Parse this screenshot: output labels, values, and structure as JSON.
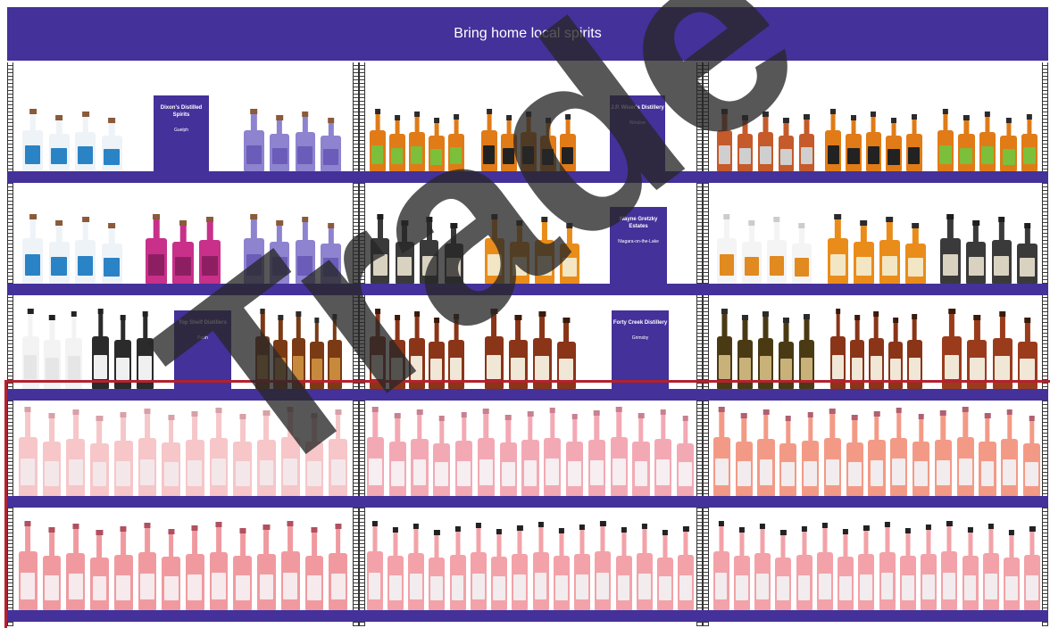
{
  "banner": {
    "title": "Bring home local spirits"
  },
  "colors": {
    "shelf": "#44319a",
    "frame": "#b3222e"
  },
  "signs": [
    {
      "name": "Dixon's Distilled Spirits",
      "city": "Guelph"
    },
    {
      "name": "J.P. Wiser's Distillery",
      "city": "Windsor"
    },
    {
      "name": "Wayne Gretzky Estates",
      "city": "Niagara-on-the-Lake"
    },
    {
      "name": "Top Shelf Distillers",
      "city": "Perth"
    },
    {
      "name": "Forty Creek Distillery",
      "city": "Grimsby"
    }
  ],
  "watermark": {
    "text": "Trade"
  },
  "shelves": [
    {
      "name": "spirits-row-1"
    },
    {
      "name": "spirits-row-2"
    },
    {
      "name": "spirits-row-3"
    },
    {
      "name": "rose-row-1"
    },
    {
      "name": "rose-row-2"
    }
  ],
  "product_groups": [
    {
      "row": 0,
      "count": 4,
      "glass": "#eef3f8",
      "label": "#2a83c5",
      "cap": "#8a5a3a"
    },
    {
      "row": 0,
      "count": 4,
      "glass": "#8d83cf",
      "label": "#6a5cb8",
      "cap": "#8a5a3a"
    },
    {
      "row": 0,
      "count": 5,
      "glass": "#e07b17",
      "label": "#7bbf3a",
      "cap": "#2b2b2b"
    },
    {
      "row": 0,
      "count": 5,
      "glass": "#e07b17",
      "label": "#222222",
      "cap": "#2b2b2b"
    },
    {
      "row": 0,
      "count": 5,
      "glass": "#c55a2a",
      "label": "#cfcfcf",
      "cap": "#2b2b2b"
    },
    {
      "row": 0,
      "count": 5,
      "glass": "#e07b17",
      "label": "#222222",
      "cap": "#2b2b2b"
    },
    {
      "row": 0,
      "count": 5,
      "glass": "#e07b17",
      "label": "#7bbf3a",
      "cap": "#2b2b2b"
    },
    {
      "row": 1,
      "count": 4,
      "glass": "#eef3f8",
      "label": "#2a83c5",
      "cap": "#8a5a3a"
    },
    {
      "row": 1,
      "count": 3,
      "glass": "#c8308a",
      "label": "#8e1e62",
      "cap": "#8a5a3a"
    },
    {
      "row": 1,
      "count": 4,
      "glass": "#8d83cf",
      "label": "#6a5cb8",
      "cap": "#8a5a3a"
    },
    {
      "row": 1,
      "count": 4,
      "glass": "#3a3a3a",
      "label": "#d9d2c0",
      "cap": "#1e1e1e"
    },
    {
      "row": 1,
      "count": 4,
      "glass": "#e98c1a",
      "label": "#f3e6c4",
      "cap": "#2b2b2b"
    },
    {
      "row": 1,
      "count": 4,
      "glass": "#f4f4f4",
      "label": "#e08a1f",
      "cap": "#cccccc"
    },
    {
      "row": 1,
      "count": 4,
      "glass": "#e98c1a",
      "label": "#f3e6c4",
      "cap": "#2b2b2b"
    },
    {
      "row": 1,
      "count": 4,
      "glass": "#3a3a3a",
      "label": "#d9d2c0",
      "cap": "#1e1e1e"
    },
    {
      "row": 2,
      "count": 3,
      "glass": "#f3f3f3",
      "label": "#e6e6e6",
      "cap": "#222222"
    },
    {
      "row": 2,
      "count": 3,
      "glass": "#2b2b2b",
      "label": "#f0f0f0",
      "cap": "#222222"
    },
    {
      "row": 2,
      "count": 5,
      "glass": "#7a3a14",
      "label": "#c78a3c",
      "cap": "#2b2b2b"
    },
    {
      "row": 2,
      "count": 5,
      "glass": "#8a3418",
      "label": "#f1e7d6",
      "cap": "#3a1a0a"
    },
    {
      "row": 2,
      "count": 4,
      "glass": "#8a3418",
      "label": "#f1e7d6",
      "cap": "#3a1a0a"
    },
    {
      "row": 2,
      "count": 5,
      "glass": "#4a3a14",
      "label": "#c8b27a",
      "cap": "#2b2b2b"
    },
    {
      "row": 2,
      "count": 5,
      "glass": "#8a3418",
      "label": "#f1e7d6",
      "cap": "#3a1a0a"
    },
    {
      "row": 2,
      "count": 4,
      "glass": "#9a3c1c",
      "label": "#f1e7d6",
      "cap": "#3a1a0a"
    },
    {
      "row": 3,
      "count": 14,
      "glass": "#f6c6c8",
      "label": "#f4e7ea",
      "cap": "#d8a0a8"
    },
    {
      "row": 3,
      "count": 15,
      "glass": "#f3a9b4",
      "label": "#f6eef0",
      "cap": "#c98090"
    },
    {
      "row": 3,
      "count": 15,
      "glass": "#f39a86",
      "label": "#f2ecee",
      "cap": "#b06070"
    },
    {
      "row": 4,
      "count": 14,
      "glass": "#f09aa0",
      "label": "#f6eaec",
      "cap": "#b05060"
    },
    {
      "row": 4,
      "count": 16,
      "glass": "#f2a2a8",
      "label": "#f2ecee",
      "cap": "#222222"
    },
    {
      "row": 4,
      "count": 16,
      "glass": "#f2a2a8",
      "label": "#f2ecee",
      "cap": "#222222"
    }
  ]
}
